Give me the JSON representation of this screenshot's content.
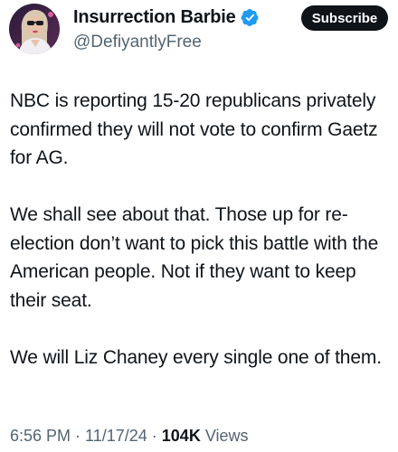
{
  "author": {
    "display_name": "Insurrection Barbie",
    "handle": "@DefiyantlyFree",
    "verified": true,
    "avatar_icon": "avatar-photo"
  },
  "subscribe_label": "Subscribe",
  "tweet": {
    "paragraphs": [
      "NBC is reporting 15-20 republicans privately confirmed they will not vote to confirm Gaetz for AG.",
      "We shall see about that. Those up for re-election don’t want to pick this battle with the American people. Not if they want to keep their seat.",
      "We will Liz Chaney every single one of them."
    ]
  },
  "meta": {
    "time": "6:56 PM",
    "sep1": " · ",
    "date": "11/17/24",
    "sep2": " · ",
    "views_count": "104K",
    "views_label": " Views"
  },
  "colors": {
    "text": "#0f1419",
    "secondary": "#536471",
    "verified_blue": "#1d9bf0",
    "button_bg": "#0f1419"
  }
}
